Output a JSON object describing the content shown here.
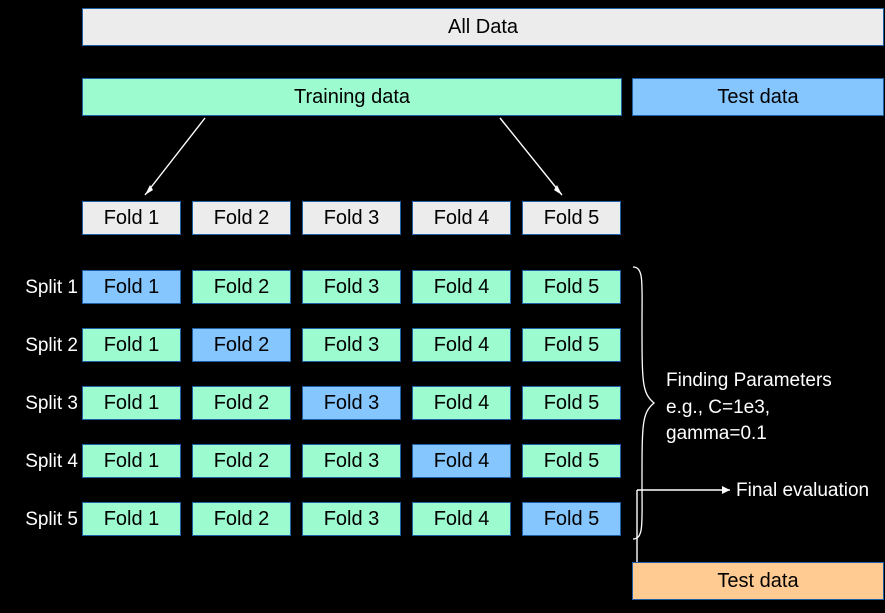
{
  "header": {
    "all_data": "All Data"
  },
  "split_row": {
    "training": "Training data",
    "test": "Test data"
  },
  "side_labels": {
    "split1": "Split 1",
    "split2": "Split 2",
    "split3": "Split 3",
    "split4": "Split 4",
    "split5": "Split 5"
  },
  "fold_labels": {
    "f1": "Fold 1",
    "f2": "Fold 2",
    "f3": "Fold 3",
    "f4": "Fold 4",
    "f5": "Fold 5"
  },
  "find_params": {
    "line1": "Finding Parameters",
    "line2": "e.g., C=1e3,",
    "line3": "gamma=0.1"
  },
  "final": {
    "eval": "Final evaluation",
    "test": "Test data"
  },
  "chart_data": {
    "type": "table",
    "description": "5-fold cross-validation diagram. Blue = validation fold, green = training folds, grey = neutral labels.",
    "folds": [
      "Fold 1",
      "Fold 2",
      "Fold 3",
      "Fold 4",
      "Fold 5"
    ],
    "header_row": {
      "colors": [
        "grey",
        "grey",
        "grey",
        "grey",
        "grey"
      ]
    },
    "splits": [
      {
        "name": "Split 1",
        "validation_fold": 1,
        "colors": [
          "blue",
          "green",
          "green",
          "green",
          "green"
        ]
      },
      {
        "name": "Split 2",
        "validation_fold": 2,
        "colors": [
          "green",
          "blue",
          "green",
          "green",
          "green"
        ]
      },
      {
        "name": "Split 3",
        "validation_fold": 3,
        "colors": [
          "green",
          "green",
          "blue",
          "green",
          "green"
        ]
      },
      {
        "name": "Split 4",
        "validation_fold": 4,
        "colors": [
          "green",
          "green",
          "green",
          "blue",
          "green"
        ]
      },
      {
        "name": "Split 5",
        "validation_fold": 5,
        "colors": [
          "green",
          "green",
          "green",
          "green",
          "blue"
        ]
      }
    ],
    "top_split": {
      "training": "Training data",
      "test": "Test data"
    },
    "final_test": "Test data"
  }
}
